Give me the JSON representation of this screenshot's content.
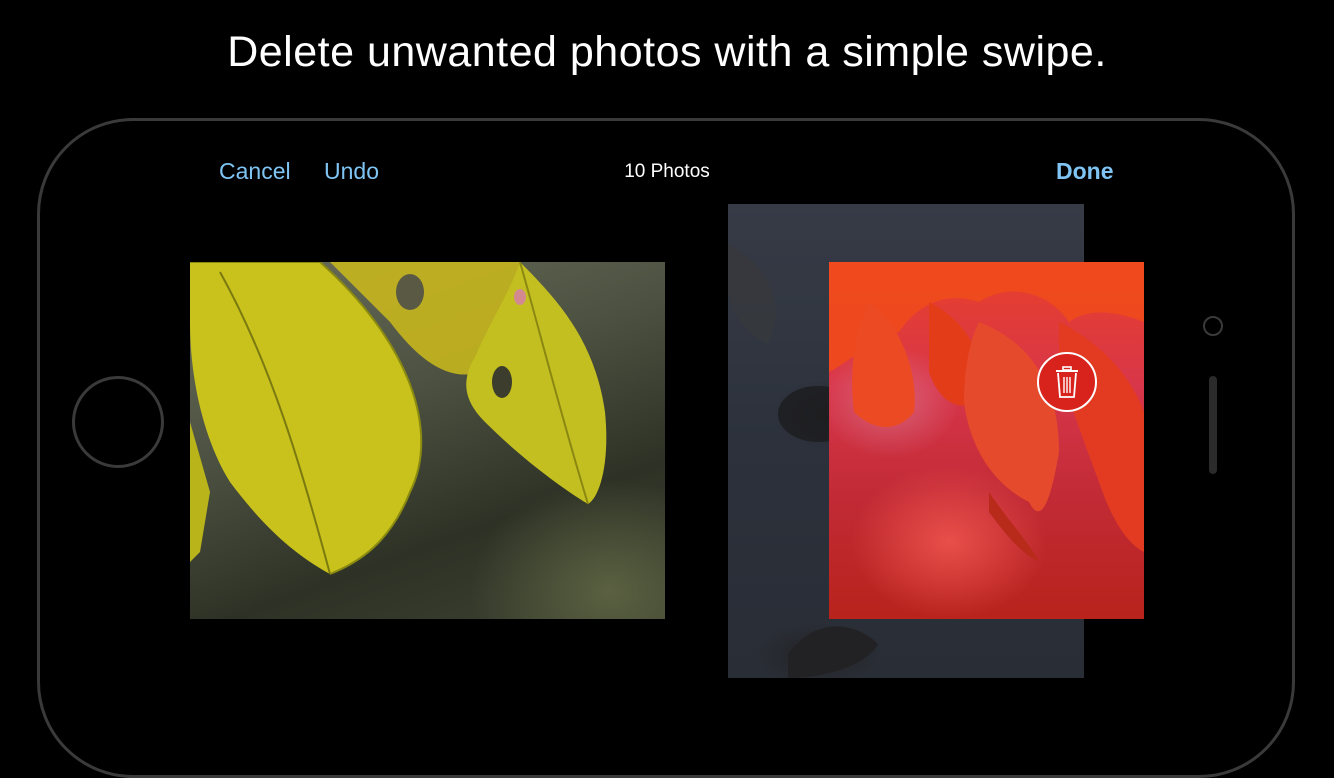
{
  "headline": "Delete unwanted photos with a simple swipe.",
  "toolbar": {
    "cancel_label": "Cancel",
    "undo_label": "Undo",
    "photo_count": "10 Photos",
    "done_label": "Done"
  },
  "colors": {
    "accent": "#7fc4f2",
    "background": "#000000",
    "delete": "#d8221c"
  },
  "icons": {
    "delete": "trash-icon"
  }
}
